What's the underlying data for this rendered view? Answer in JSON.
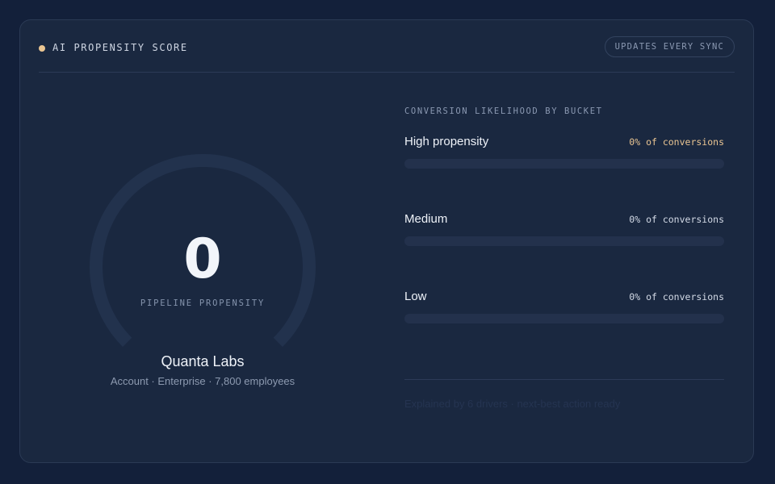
{
  "header": {
    "title": "AI PROPENSITY SCORE",
    "sync_label": "UPDATES EVERY SYNC",
    "accent_color": "#eac592"
  },
  "score": {
    "value": "0",
    "label": "PIPELINE PROPENSITY",
    "gauge_fraction": 0
  },
  "account": {
    "name": "Quanta Labs",
    "meta": "Account · Enterprise · 7,800 employees"
  },
  "buckets": {
    "title": "CONVERSION LIKELIHOOD BY BUCKET",
    "items": [
      {
        "name": "High propensity",
        "pct_label": "0% of conversions",
        "fraction": 0
      },
      {
        "name": "Medium",
        "pct_label": "0% of conversions",
        "fraction": 0
      },
      {
        "name": "Low",
        "pct_label": "0% of conversions",
        "fraction": 0
      }
    ]
  },
  "footer": {
    "note": "Explained by 6 drivers · next-best action ready"
  }
}
